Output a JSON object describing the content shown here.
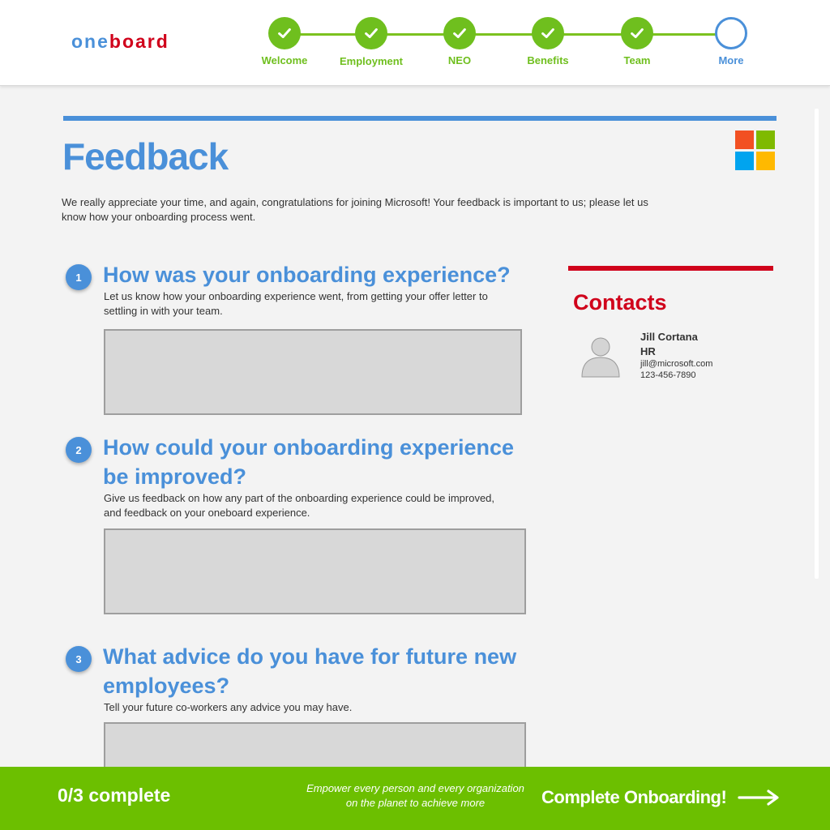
{
  "app": {
    "logo_part1": "one",
    "logo_part2": "board"
  },
  "steps": [
    {
      "label": "Welcome",
      "done": true
    },
    {
      "label": "Employment",
      "done": true
    },
    {
      "label": "NEO",
      "done": true
    },
    {
      "label": "Benefits",
      "done": true
    },
    {
      "label": "Team",
      "done": true
    },
    {
      "label": "More",
      "done": false,
      "active": true
    }
  ],
  "page": {
    "title": "Feedback",
    "intro": "We really appreciate your time, and again, congratulations for joining Microsoft! Your feedback is important to us; please let us know how your onboarding process went."
  },
  "questions": [
    {
      "number": "1",
      "title": "How was your onboarding experience?",
      "description": "Let us know how your onboarding experience went, from getting your offer letter to settling in with your team."
    },
    {
      "number": "2",
      "title": "How could your onboarding experience be improved?",
      "description": "Give us feedback on how any part of the onboarding experience could be improved, and feedback on your oneboard experience."
    },
    {
      "number": "3",
      "title": "What advice do you have for future new employees?",
      "description": "Tell your future co-workers any advice you may have."
    }
  ],
  "contacts": {
    "title": "Contacts",
    "items": [
      {
        "name": "Jill Cortana",
        "role": "HR",
        "email": "jill@microsoft.com",
        "phone": "123-456-7890"
      }
    ]
  },
  "footer": {
    "progress": "0/3 complete",
    "tagline": "Empower every person and every organization on the planet to achieve more",
    "complete_label": "Complete Onboarding!"
  },
  "colors": {
    "primary_blue": "#4a90d9",
    "brand_red": "#d0021b",
    "success_green": "#6cbf00",
    "ms_red": "#f25022",
    "ms_green": "#7fba00",
    "ms_blue": "#00a4ef",
    "ms_yellow": "#ffb900"
  },
  "icons": {
    "step_done": "checkmark-icon",
    "avatar": "person-icon",
    "complete": "arrow-right-icon",
    "brand": "microsoft-logo"
  }
}
